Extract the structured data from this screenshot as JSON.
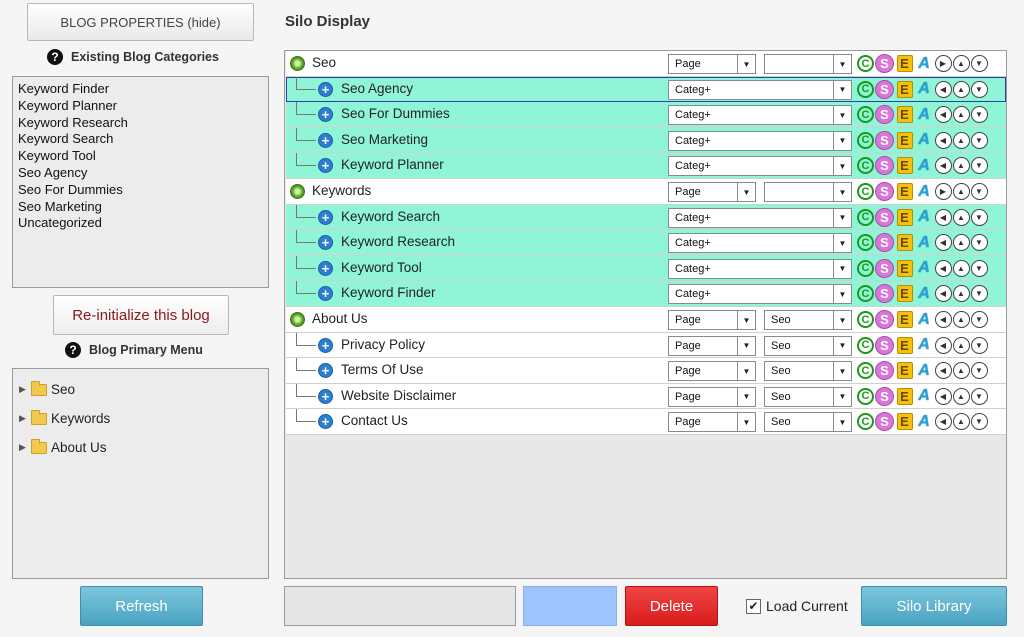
{
  "left": {
    "blog_properties_label": "BLOG PROPERTIES (hide)",
    "categories_heading": "Existing Blog Categories",
    "categories": [
      "Keyword Finder",
      "Keyword Planner",
      "Keyword Research",
      "Keyword Search",
      "Keyword Tool",
      "Seo Agency",
      "Seo For Dummies",
      "Seo Marketing",
      "Uncategorized"
    ],
    "reinit_label": "Re-initialize this blog",
    "menu_heading": "Blog Primary Menu",
    "menu_items": [
      "Seo",
      "Keywords",
      "About Us"
    ],
    "refresh_label": "Refresh"
  },
  "silo": {
    "title": "Silo Display",
    "icon_glyphs": {
      "c": "C",
      "s": "S",
      "e": "E",
      "a": "A"
    },
    "rows": [
      {
        "label": "Seo",
        "level": 0,
        "type": "Page",
        "target": "",
        "move": "right"
      },
      {
        "label": "Seo Agency",
        "level": 1,
        "type": "Categ+",
        "target": null,
        "selected": true,
        "move": "left"
      },
      {
        "label": "Seo For Dummies",
        "level": 1,
        "type": "Categ+",
        "target": null,
        "move": "left"
      },
      {
        "label": "Seo Marketing",
        "level": 1,
        "type": "Categ+",
        "target": null,
        "move": "left"
      },
      {
        "label": "Keyword Planner",
        "level": 1,
        "type": "Categ+",
        "target": null,
        "move": "left"
      },
      {
        "label": "Keywords",
        "level": 0,
        "type": "Page",
        "target": "",
        "move": "right"
      },
      {
        "label": "Keyword Search",
        "level": 1,
        "type": "Categ+",
        "target": null,
        "move": "left"
      },
      {
        "label": "Keyword Research",
        "level": 1,
        "type": "Categ+",
        "target": null,
        "move": "left"
      },
      {
        "label": "Keyword Tool",
        "level": 1,
        "type": "Categ+",
        "target": null,
        "move": "left"
      },
      {
        "label": "Keyword Finder",
        "level": 1,
        "type": "Categ+",
        "target": null,
        "move": "left"
      },
      {
        "label": "About Us",
        "level": 0,
        "type": "Page",
        "target": "Seo",
        "move": "left"
      },
      {
        "label": "Privacy Policy",
        "level": 1,
        "type": "Page",
        "target": "Seo",
        "move": "left",
        "page_child": true
      },
      {
        "label": "Terms Of Use",
        "level": 1,
        "type": "Page",
        "target": "Seo",
        "move": "left",
        "page_child": true
      },
      {
        "label": "Website Disclaimer",
        "level": 1,
        "type": "Page",
        "target": "Seo",
        "move": "left",
        "page_child": true
      },
      {
        "label": "Contact Us",
        "level": 1,
        "type": "Page",
        "target": "Seo",
        "move": "left",
        "page_child": true
      }
    ]
  },
  "bottom": {
    "input_value": "",
    "delete_label": "Delete",
    "load_current_label": "Load Current",
    "load_current_checked": true,
    "check_glyph": "✔",
    "silo_library_label": "Silo Library"
  },
  "colors": {
    "category_row": "#8ff5d6",
    "delete": "#e02a2a",
    "action_blue": "#5ab0cc"
  }
}
